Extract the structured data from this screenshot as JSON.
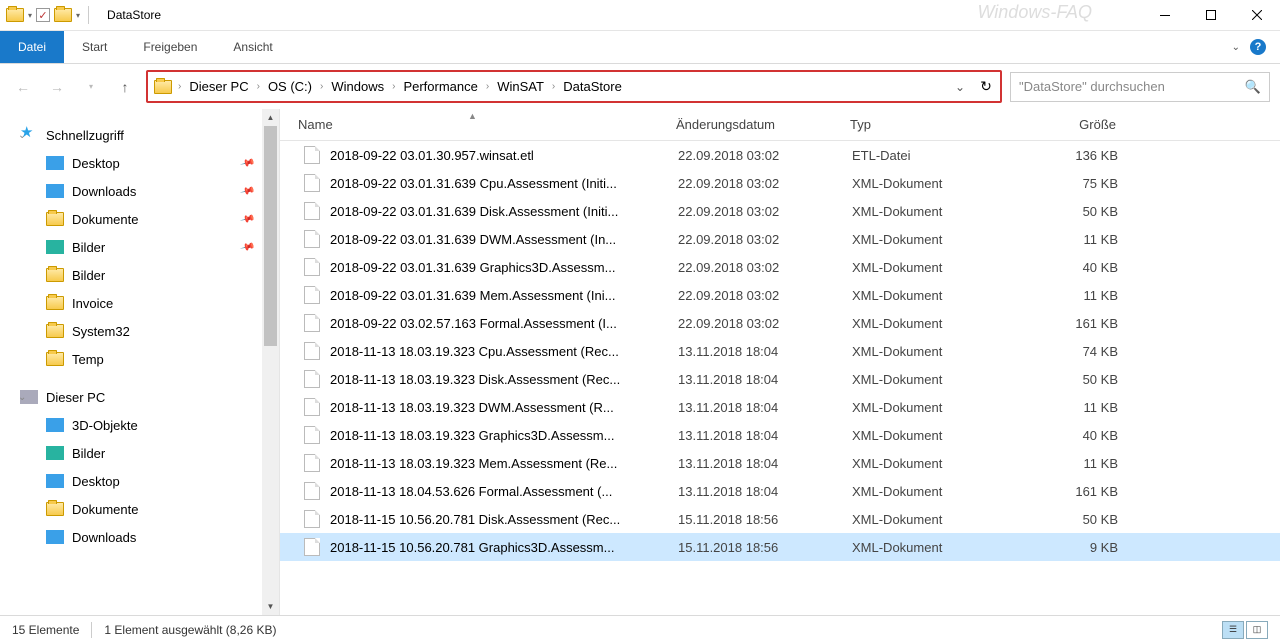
{
  "window": {
    "title": "DataStore",
    "watermark": "Windows-FAQ"
  },
  "ribbon": {
    "file": "Datei",
    "tabs": [
      "Start",
      "Freigeben",
      "Ansicht"
    ]
  },
  "nav": {
    "breadcrumbs": [
      "Dieser PC",
      "OS (C:)",
      "Windows",
      "Performance",
      "WinSAT",
      "DataStore"
    ],
    "search_placeholder": "\"DataStore\" durchsuchen"
  },
  "tree": {
    "quick": "Schnellzugriff",
    "quick_items": [
      "Desktop",
      "Downloads",
      "Dokumente",
      "Bilder",
      "Bilder",
      "Invoice",
      "System32",
      "Temp"
    ],
    "this_pc": "Dieser PC",
    "pc_items": [
      "3D-Objekte",
      "Bilder",
      "Desktop",
      "Dokumente",
      "Downloads"
    ]
  },
  "columns": {
    "name": "Name",
    "date": "Änderungsdatum",
    "type": "Typ",
    "size": "Größe"
  },
  "files": [
    {
      "name": "2018-09-22 03.01.30.957.winsat.etl",
      "date": "22.09.2018 03:02",
      "type": "ETL-Datei",
      "size": "136 KB"
    },
    {
      "name": "2018-09-22 03.01.31.639 Cpu.Assessment (Initi...",
      "date": "22.09.2018 03:02",
      "type": "XML-Dokument",
      "size": "75 KB"
    },
    {
      "name": "2018-09-22 03.01.31.639 Disk.Assessment (Initi...",
      "date": "22.09.2018 03:02",
      "type": "XML-Dokument",
      "size": "50 KB"
    },
    {
      "name": "2018-09-22 03.01.31.639 DWM.Assessment (In...",
      "date": "22.09.2018 03:02",
      "type": "XML-Dokument",
      "size": "11 KB"
    },
    {
      "name": "2018-09-22 03.01.31.639 Graphics3D.Assessm...",
      "date": "22.09.2018 03:02",
      "type": "XML-Dokument",
      "size": "40 KB"
    },
    {
      "name": "2018-09-22 03.01.31.639 Mem.Assessment (Ini...",
      "date": "22.09.2018 03:02",
      "type": "XML-Dokument",
      "size": "11 KB"
    },
    {
      "name": "2018-09-22 03.02.57.163 Formal.Assessment (I...",
      "date": "22.09.2018 03:02",
      "type": "XML-Dokument",
      "size": "161 KB"
    },
    {
      "name": "2018-11-13 18.03.19.323 Cpu.Assessment (Rec...",
      "date": "13.11.2018 18:04",
      "type": "XML-Dokument",
      "size": "74 KB"
    },
    {
      "name": "2018-11-13 18.03.19.323 Disk.Assessment (Rec...",
      "date": "13.11.2018 18:04",
      "type": "XML-Dokument",
      "size": "50 KB"
    },
    {
      "name": "2018-11-13 18.03.19.323 DWM.Assessment (R...",
      "date": "13.11.2018 18:04",
      "type": "XML-Dokument",
      "size": "11 KB"
    },
    {
      "name": "2018-11-13 18.03.19.323 Graphics3D.Assessm...",
      "date": "13.11.2018 18:04",
      "type": "XML-Dokument",
      "size": "40 KB"
    },
    {
      "name": "2018-11-13 18.03.19.323 Mem.Assessment (Re...",
      "date": "13.11.2018 18:04",
      "type": "XML-Dokument",
      "size": "11 KB"
    },
    {
      "name": "2018-11-13 18.04.53.626 Formal.Assessment (...",
      "date": "13.11.2018 18:04",
      "type": "XML-Dokument",
      "size": "161 KB"
    },
    {
      "name": "2018-11-15 10.56.20.781 Disk.Assessment (Rec...",
      "date": "15.11.2018 18:56",
      "type": "XML-Dokument",
      "size": "50 KB"
    },
    {
      "name": "2018-11-15 10.56.20.781 Graphics3D.Assessm...",
      "date": "15.11.2018 18:56",
      "type": "XML-Dokument",
      "size": "9 KB",
      "selected": true
    }
  ],
  "status": {
    "count": "15 Elemente",
    "selection": "1 Element ausgewählt (8,26 KB)"
  }
}
